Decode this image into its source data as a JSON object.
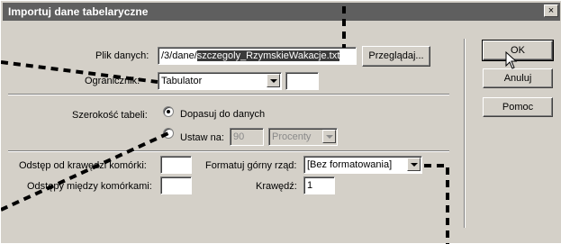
{
  "dialog": {
    "title": "Importuj dane tabelaryczne",
    "close_glyph": "×"
  },
  "form": {
    "file_label": "Plik danych:",
    "file_value_prefix": "/3/dane/",
    "file_value_selected": "szczegoly_RzymskieWakacje.txt",
    "browse_label": "Przeglądaj...",
    "delimiter_label": "Ogranicznik:",
    "delimiter_value": "Tabulator",
    "delimiter_other": "",
    "table_width_label": "Szerokość tabeli:",
    "fit_label": "Dopasuj do danych",
    "set_label": "Ustaw na:",
    "set_value": "90",
    "unit_value": "Procenty",
    "cell_padding_label": "Odstęp od krawędzi komórki:",
    "cell_padding_value": "",
    "cell_spacing_label": "Odstępy między komórkami:",
    "cell_spacing_value": "",
    "format_row_label": "Formatuj górny rząd:",
    "format_row_value": "[Bez formatowania]",
    "border_label": "Krawędź:",
    "border_value": "1"
  },
  "buttons": {
    "ok": "OK",
    "cancel": "Anuluj",
    "help": "Pomoc"
  },
  "state": {
    "width_mode": "fit"
  }
}
